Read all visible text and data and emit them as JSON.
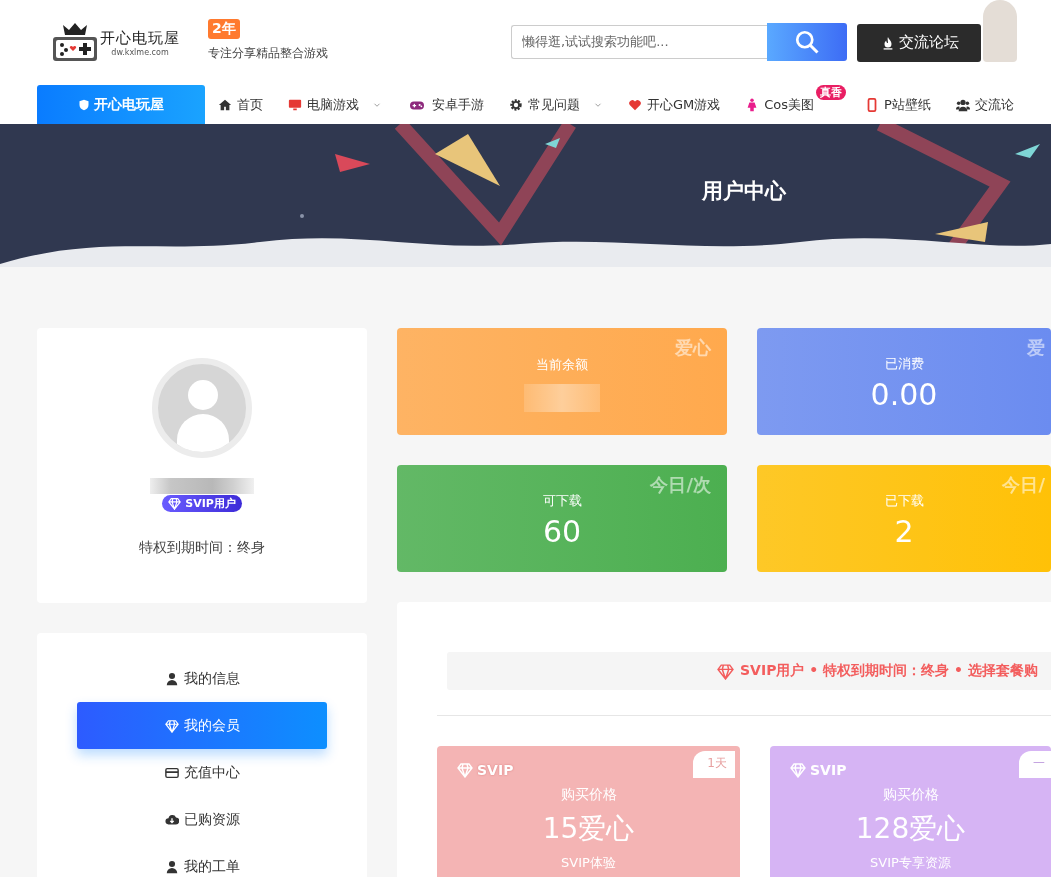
{
  "header": {
    "logo_text": "开心电玩屋",
    "logo_domain": "dw.kxlme.com",
    "age_badge": "2年",
    "tagline": "专注分享精品整合游戏",
    "search": {
      "placeholder": "懒得逛,试试搜索功能吧..."
    },
    "forum_button": "交流论坛"
  },
  "nav": {
    "brand": "开心电玩屋",
    "items": [
      {
        "label": "首页",
        "kind": "home",
        "caret": false
      },
      {
        "label": "电脑游戏",
        "kind": "monitor",
        "caret": true
      },
      {
        "label": "安卓手游",
        "kind": "gamepad",
        "caret": false
      },
      {
        "label": "常见问题",
        "kind": "gear",
        "caret": true
      },
      {
        "label": "开心GM游戏",
        "kind": "heart",
        "caret": false
      },
      {
        "label": "Cos美图",
        "kind": "figure",
        "caret": false,
        "badge": "真香"
      },
      {
        "label": "P站壁纸",
        "kind": "phone",
        "caret": false
      },
      {
        "label": "交流论",
        "kind": "users",
        "caret": false
      }
    ]
  },
  "hero": {
    "title": "用户中心"
  },
  "profile": {
    "vip_badge": "SVIP用户",
    "expiry": "特权到期时间：终身"
  },
  "menu": [
    {
      "label": "我的信息",
      "kind": "user",
      "selected": false
    },
    {
      "label": "我的会员",
      "kind": "diamond",
      "selected": true
    },
    {
      "label": "充值中心",
      "kind": "card",
      "selected": false
    },
    {
      "label": "已购资源",
      "kind": "cloud",
      "selected": false
    },
    {
      "label": "我的工单",
      "kind": "user",
      "selected": false
    }
  ],
  "stats": [
    {
      "label": "当前余额",
      "masked": true,
      "corner": "爱心",
      "color": "#ffa94d"
    },
    {
      "label": "已消费",
      "value": "0.00",
      "corner": "爱",
      "color": "#6b8cf0"
    },
    {
      "label": "可下载",
      "value": "60",
      "corner": "今日/次",
      "color": "#4caf50"
    },
    {
      "label": "已下载",
      "value": "2",
      "corner": "今日/",
      "color": "#ffc107"
    }
  ],
  "membership": {
    "notice": "SVIP用户 • 特权到期时间：终身 • 选择套餐购",
    "plans": [
      {
        "tier": "SVIP",
        "tag": "1天",
        "price_label": "购买价格",
        "price": "15爱心",
        "description": "SVIP体验",
        "color": "#f4b4b4"
      },
      {
        "tier": "SVIP",
        "tag": "一",
        "price_label": "购买价格",
        "price": "128爱心",
        "description": "SVIP专享资源",
        "color": "#d6b4f4"
      }
    ]
  }
}
